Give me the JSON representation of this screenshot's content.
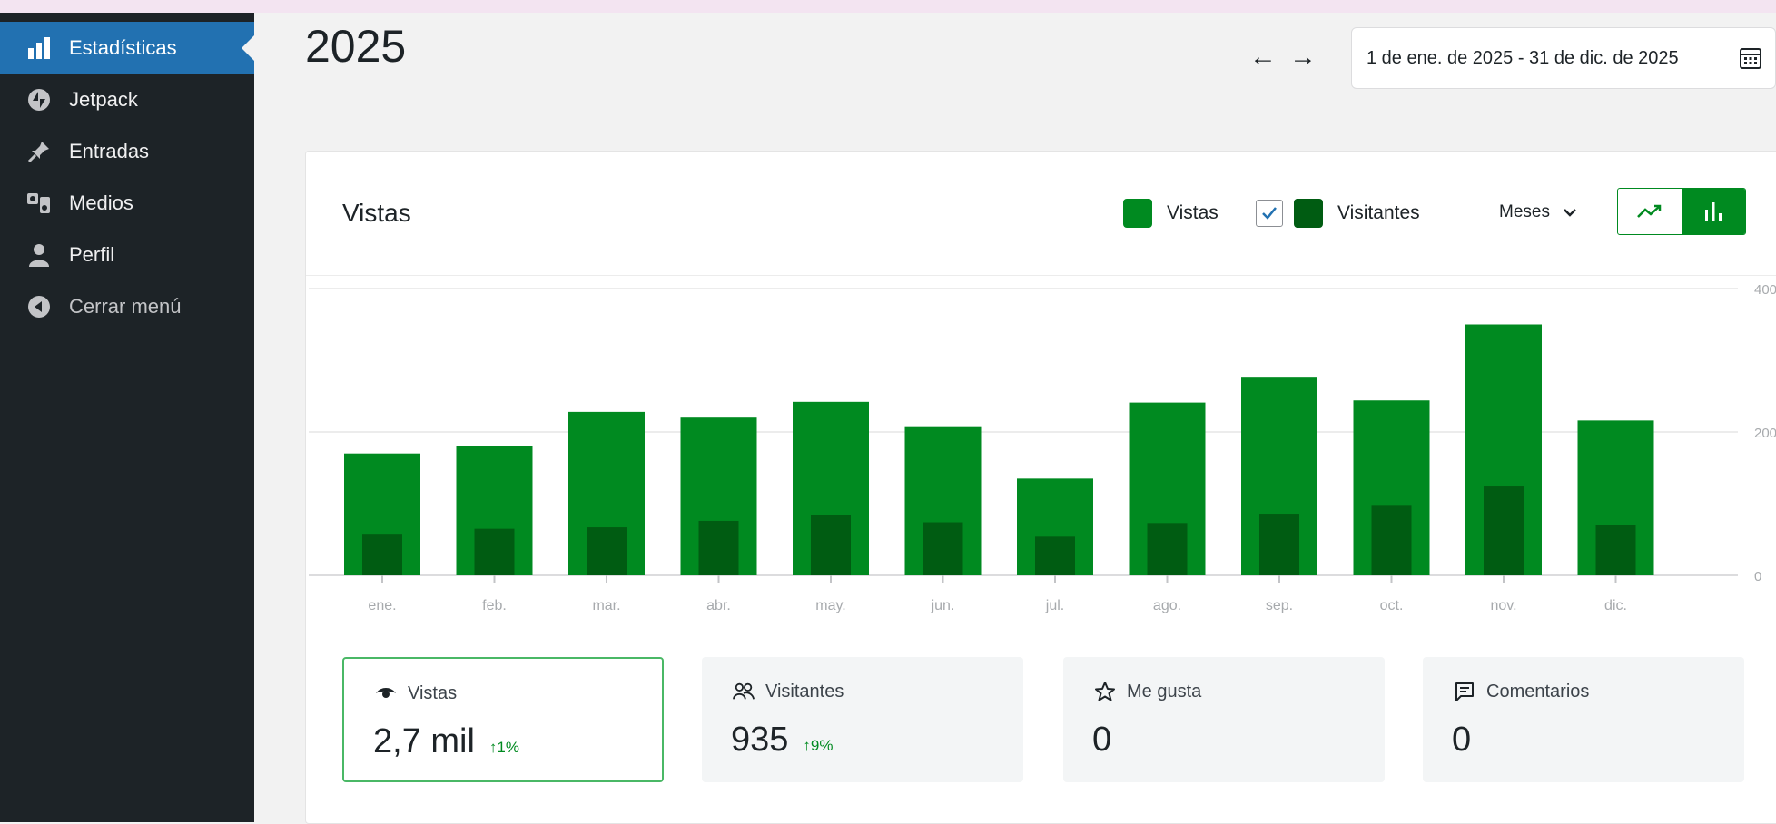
{
  "sidebar": {
    "items": [
      {
        "label": "Estadísticas",
        "icon": "bar-chart-icon",
        "active": true
      },
      {
        "label": "Jetpack",
        "icon": "jetpack-icon"
      },
      {
        "label": "Entradas",
        "icon": "pin-icon"
      },
      {
        "label": "Medios",
        "icon": "media-icon"
      },
      {
        "label": "Perfil",
        "icon": "user-icon"
      },
      {
        "label": "Cerrar menú",
        "icon": "collapse-icon"
      }
    ]
  },
  "header": {
    "title": "2025",
    "prev_arrow": "←",
    "next_arrow": "→",
    "date_range": "1 de ene. de 2025 - 31 de dic. de 2025"
  },
  "card": {
    "title": "Vistas",
    "legend": [
      {
        "label": "Vistas",
        "color": "#008a20"
      },
      {
        "label": "Visitantes",
        "color": "#005c12",
        "checked": true
      }
    ],
    "period_select": "Meses"
  },
  "chart_data": {
    "type": "bar",
    "categories": [
      "ene.",
      "feb.",
      "mar.",
      "abr.",
      "may.",
      "jun.",
      "jul.",
      "ago.",
      "sep.",
      "oct.",
      "nov.",
      "dic."
    ],
    "series": [
      {
        "name": "Vistas",
        "color": "#008a20",
        "values": [
          170,
          180,
          228,
          220,
          242,
          208,
          135,
          241,
          277,
          244,
          350,
          216
        ]
      },
      {
        "name": "Visitantes",
        "color": "#005c12",
        "values": [
          58,
          65,
          67,
          76,
          84,
          74,
          54,
          73,
          86,
          97,
          124,
          70
        ]
      }
    ],
    "ylim": [
      0,
      400
    ],
    "yticks": [
      0,
      200,
      400
    ],
    "grid": true
  },
  "stats": [
    {
      "label": "Vistas",
      "icon": "eye-icon",
      "value": "2,7 mil",
      "delta": "↑1%",
      "selected": true
    },
    {
      "label": "Visitantes",
      "icon": "people-icon",
      "value": "935",
      "delta": "↑9%"
    },
    {
      "label": "Me gusta",
      "icon": "star-icon",
      "value": "0",
      "delta": ""
    },
    {
      "label": "Comentarios",
      "icon": "comment-icon",
      "value": "0",
      "delta": ""
    }
  ]
}
